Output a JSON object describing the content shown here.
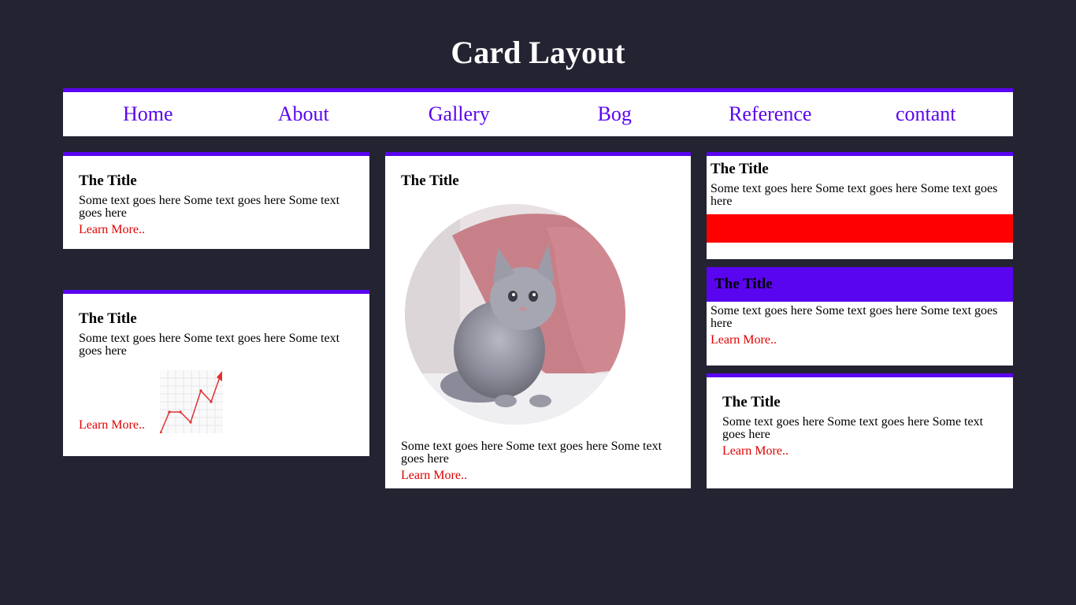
{
  "page": {
    "title": "Card Layout"
  },
  "nav": {
    "items": [
      "Home",
      "About",
      "Gallery",
      "Bog",
      "Reference",
      "contant"
    ]
  },
  "cards": [
    {
      "title": "The Title",
      "text": "Some text goes here Some text goes here Some text goes here",
      "link": "Learn More.."
    },
    {
      "title": "The Title",
      "text": "Some text goes here Some text goes here Some text goes here",
      "link": "Learn More.."
    },
    {
      "title": "The Title",
      "text": "Some text goes here Some text goes here Some text goes here",
      "link": "Learn More.."
    },
    {
      "title": "The Title",
      "text": "Some text goes here Some text goes here Some text goes here"
    },
    {
      "title": "The Title",
      "text": "Some text goes here Some text goes here Some text goes here",
      "link": "Learn More.."
    },
    {
      "title": "The Title",
      "text": "Some text goes here Some text goes here Some text goes here",
      "link": "Learn More.."
    }
  ],
  "colors": {
    "background": "#232332",
    "accent": "#5a05f0",
    "link": "#e00000",
    "banner_red": "#ff0000"
  },
  "images": {
    "kitten": "kitten-photo",
    "chart": "line-chart-icon"
  }
}
